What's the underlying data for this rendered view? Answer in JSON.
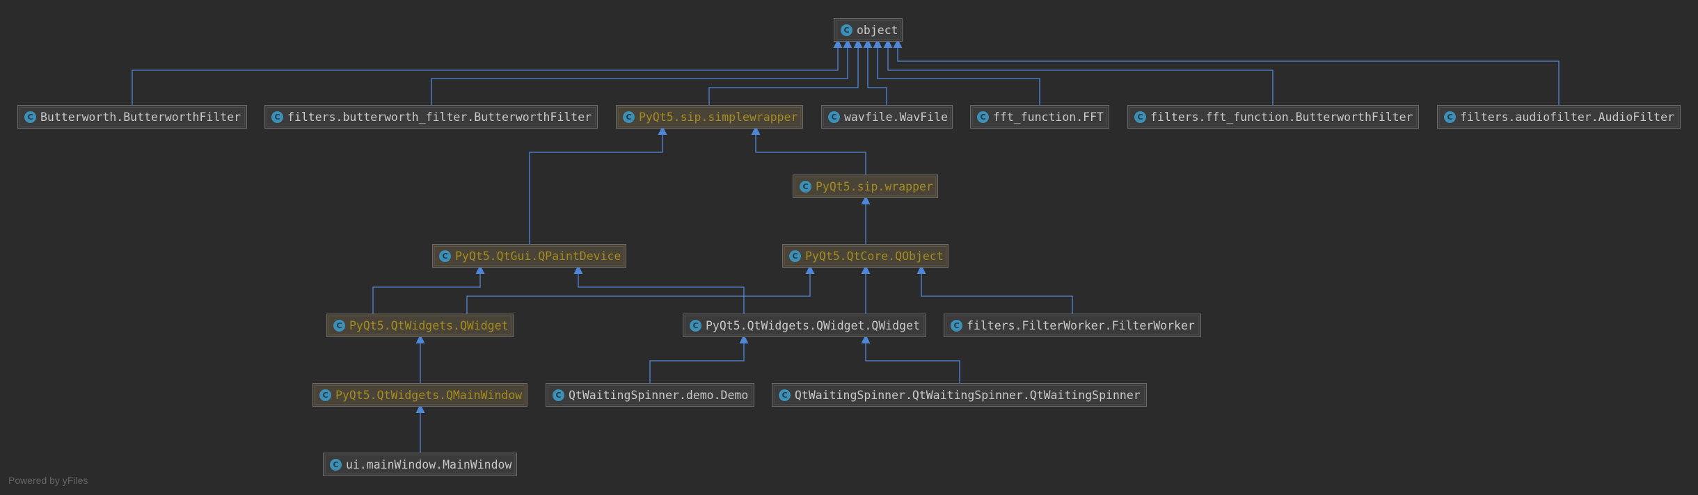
{
  "colors": {
    "background": "#2b2b2b",
    "edge": "#4f87d8",
    "library_text": "#a58c1f",
    "project_text": "#c9c9c9",
    "class_icon": "#3d8fb5"
  },
  "icon": "class-c-icon",
  "nodes": {
    "object": {
      "label": "object",
      "kind": "builtin"
    },
    "butterworth_butterworthfilter": {
      "label": "Butterworth.ButterworthFilter",
      "kind": "project"
    },
    "filters_butterworth_filter": {
      "label": "filters.butterworth_filter.ButterworthFilter",
      "kind": "project"
    },
    "simplewrapper": {
      "label": "PyQt5.sip.simplewrapper",
      "kind": "library"
    },
    "wavfile": {
      "label": "wavfile.WavFile",
      "kind": "project"
    },
    "fft": {
      "label": "fft_function.FFT",
      "kind": "project"
    },
    "filters_fft_butterworth": {
      "label": "filters.fft_function.ButterworthFilter",
      "kind": "project"
    },
    "audiofilter": {
      "label": "filters.audiofilter.AudioFilter",
      "kind": "project"
    },
    "wrapper": {
      "label": "PyQt5.sip.wrapper",
      "kind": "library"
    },
    "qpaintdevice": {
      "label": "PyQt5.QtGui.QPaintDevice",
      "kind": "library"
    },
    "qobject": {
      "label": "PyQt5.QtCore.QObject",
      "kind": "library"
    },
    "qwidget": {
      "label": "PyQt5.QtWidgets.QWidget",
      "kind": "library"
    },
    "qwidget_qwidget": {
      "label": "PyQt5.QtWidgets.QWidget.QWidget",
      "kind": "project"
    },
    "filterworker": {
      "label": "filters.FilterWorker.FilterWorker",
      "kind": "project"
    },
    "qmainwindow": {
      "label": "PyQt5.QtWidgets.QMainWindow",
      "kind": "library"
    },
    "demo": {
      "label": "QtWaitingSpinner.demo.Demo",
      "kind": "project"
    },
    "qtwaitingspinner": {
      "label": "QtWaitingSpinner.QtWaitingSpinner.QtWaitingSpinner",
      "kind": "project"
    },
    "mainwindow": {
      "label": "ui.mainWindow.MainWindow",
      "kind": "project"
    }
  },
  "edges": [
    {
      "from": "butterworth_butterworthfilter",
      "to": "object"
    },
    {
      "from": "filters_butterworth_filter",
      "to": "object"
    },
    {
      "from": "simplewrapper",
      "to": "object"
    },
    {
      "from": "wavfile",
      "to": "object"
    },
    {
      "from": "fft",
      "to": "object"
    },
    {
      "from": "filters_fft_butterworth",
      "to": "object"
    },
    {
      "from": "audiofilter",
      "to": "object"
    },
    {
      "from": "wrapper",
      "to": "simplewrapper"
    },
    {
      "from": "qpaintdevice",
      "to": "simplewrapper"
    },
    {
      "from": "qobject",
      "to": "wrapper"
    },
    {
      "from": "qwidget",
      "to": "qpaintdevice"
    },
    {
      "from": "qwidget",
      "to": "qobject"
    },
    {
      "from": "qwidget_qwidget",
      "to": "qpaintdevice"
    },
    {
      "from": "qwidget_qwidget",
      "to": "qobject"
    },
    {
      "from": "filterworker",
      "to": "qobject"
    },
    {
      "from": "qmainwindow",
      "to": "qwidget"
    },
    {
      "from": "demo",
      "to": "qwidget_qwidget"
    },
    {
      "from": "qtwaitingspinner",
      "to": "qwidget_qwidget"
    },
    {
      "from": "mainwindow",
      "to": "qmainwindow"
    }
  ],
  "footer": "Powered by yFiles"
}
